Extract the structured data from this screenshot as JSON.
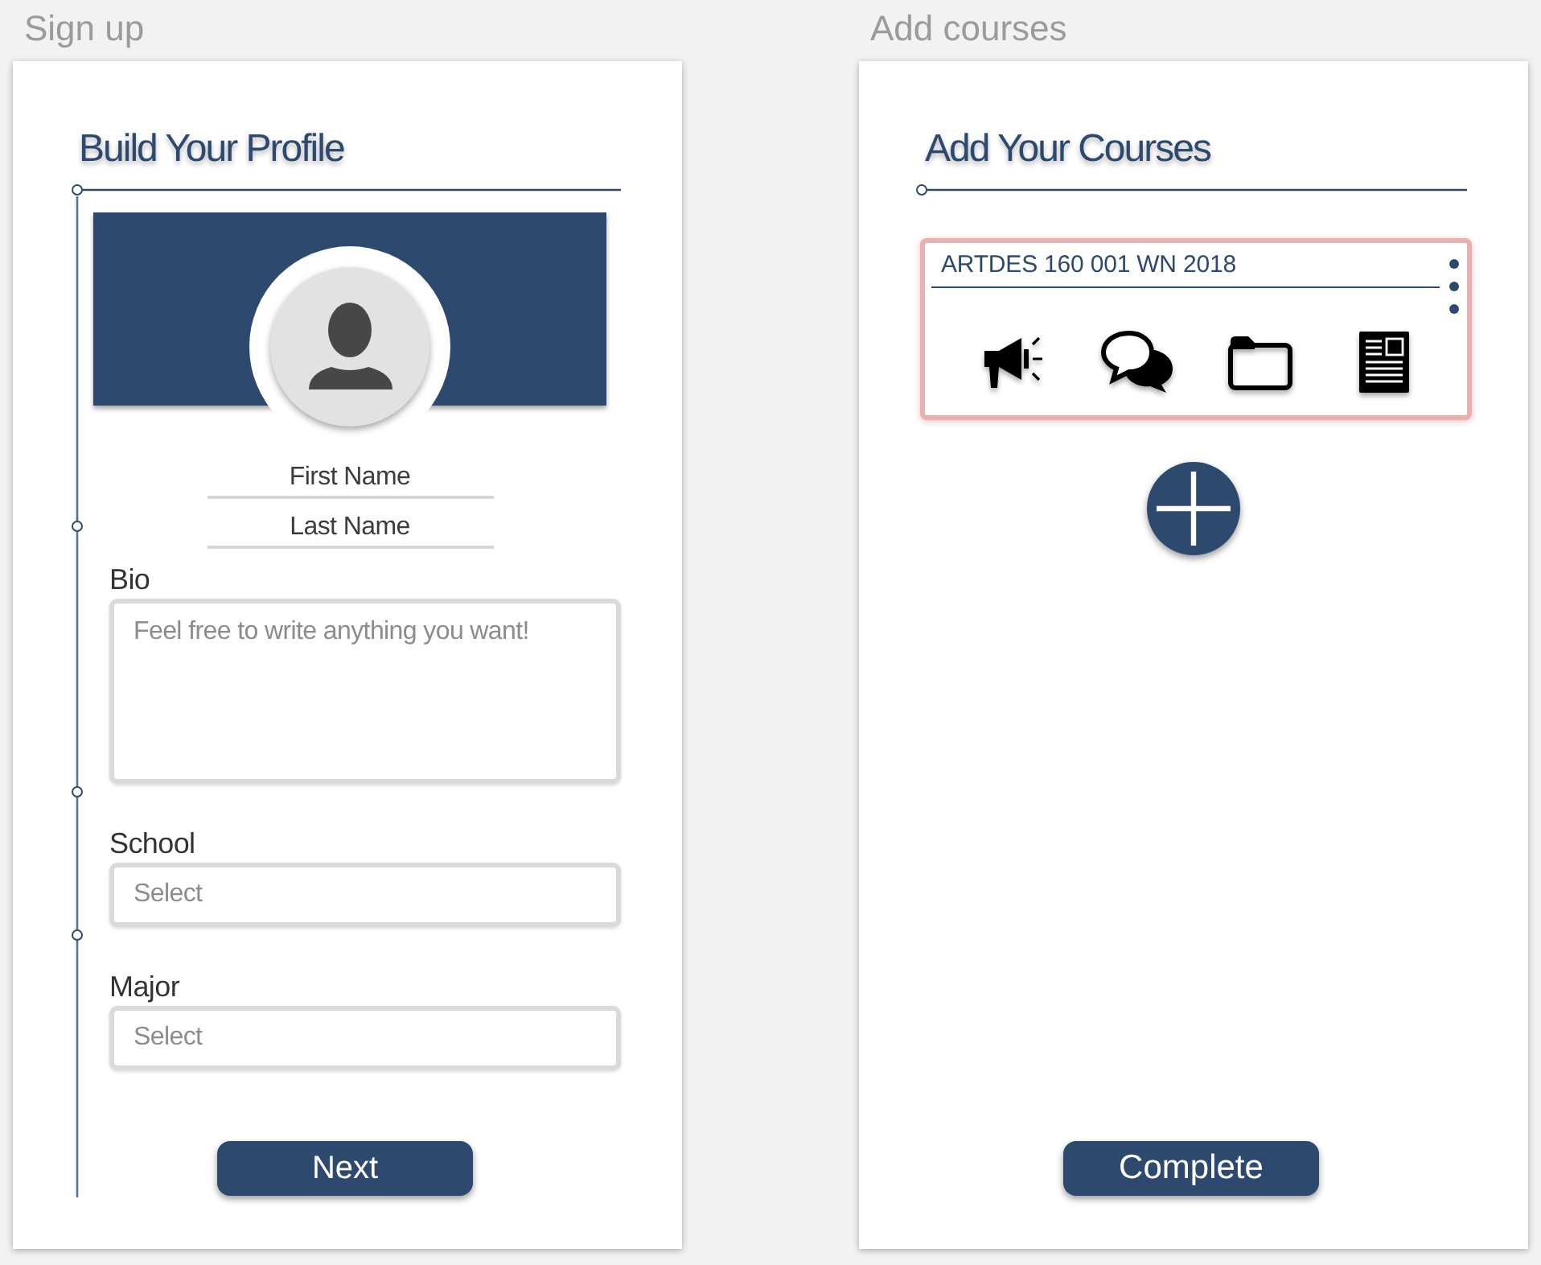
{
  "screens": [
    {
      "kind": "profile",
      "label": "Sign up",
      "title": "Build Your Profile",
      "name_fields": [
        {
          "placeholder": "First Name"
        },
        {
          "placeholder": "Last Name"
        }
      ],
      "fields": [
        {
          "kind": "textarea",
          "label": "Bio",
          "placeholder": "Feel free to write anything you want!"
        },
        {
          "kind": "select",
          "label": "School",
          "placeholder": "Select"
        },
        {
          "kind": "select",
          "label": "Major",
          "placeholder": "Select"
        }
      ],
      "button": "Next"
    },
    {
      "kind": "courses",
      "label": "Add courses",
      "title": "Add Your Courses",
      "courses": [
        {
          "name": "ARTDES 160 001 WN 2018",
          "selected": true
        }
      ],
      "button": "Complete"
    }
  ]
}
